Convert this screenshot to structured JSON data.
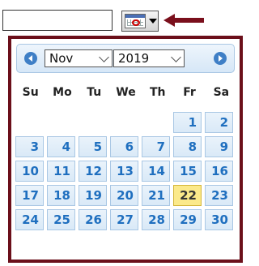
{
  "date_input": {
    "value": "",
    "placeholder": ""
  },
  "picker": {
    "month_selected": "Nov",
    "year_selected": "2019",
    "weekday_headers": [
      "Su",
      "Mo",
      "Tu",
      "We",
      "Th",
      "Fr",
      "Sa"
    ],
    "weeks": [
      [
        "",
        "",
        "",
        "",
        "",
        "1",
        "2"
      ],
      [
        "3",
        "4",
        "5",
        "6",
        "7",
        "8",
        "9"
      ],
      [
        "10",
        "11",
        "12",
        "13",
        "14",
        "15",
        "16"
      ],
      [
        "17",
        "18",
        "19",
        "20",
        "21",
        "22",
        "23"
      ],
      [
        "24",
        "25",
        "26",
        "27",
        "28",
        "29",
        "30"
      ]
    ],
    "highlighted_day": "22"
  },
  "colors": {
    "popup_border": "#6b0f1a",
    "pointer_arrow": "#7a0f1c",
    "nav_button": "#3f7fc6",
    "day_text": "#1f6fbf",
    "today_bg": "#fbe98a"
  },
  "icons": {
    "trigger": "calendar-icon",
    "prev": "chevron-left-icon",
    "next": "chevron-right-icon"
  }
}
